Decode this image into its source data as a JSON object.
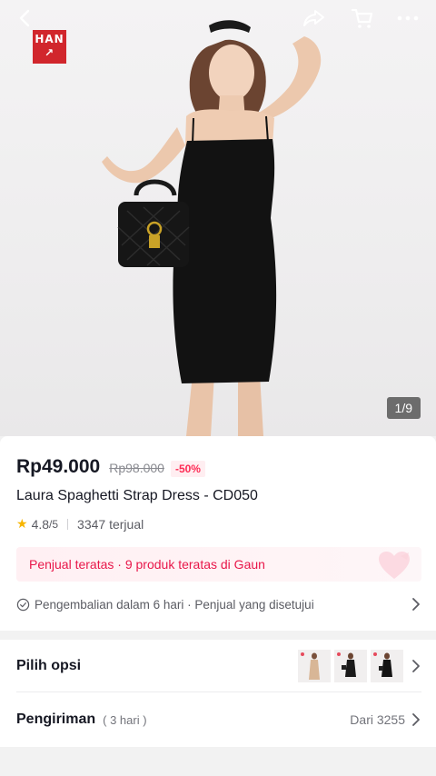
{
  "gallery": {
    "counter": "1/9"
  },
  "brand": {
    "logo_line1": "HAN",
    "logo_line2": "↗"
  },
  "product": {
    "price": "Rp49.000",
    "original_price": "Rp98.000",
    "discount": "-50%",
    "title": "Laura Spaghetti Strap Dress - CD050",
    "rating": "4.8",
    "rating_max": "/5",
    "sold": "3347 terjual"
  },
  "banner": {
    "text": "Penjual teratas · 9 produk teratas di Gaun"
  },
  "policy": {
    "text": "Pengembalian dalam 6 hari · Penjual yang disetujui"
  },
  "options": {
    "label": "Pilih opsi"
  },
  "shipping": {
    "label": "Pengiriman",
    "duration": "( 3 hari )",
    "price_from": "Dari 3255"
  },
  "icons": {
    "back": "back-arrow-icon",
    "share": "share-icon",
    "cart": "cart-icon",
    "more": "more-icon",
    "star": "star-icon",
    "check": "check-circle-icon",
    "chevron": "chevron-right-icon",
    "heart": "heart-badge-icon"
  },
  "colors": {
    "accent": "#fe2c55",
    "banner_text": "#e8174a",
    "brand_logo": "#d1262c",
    "star": "#f7b500"
  }
}
